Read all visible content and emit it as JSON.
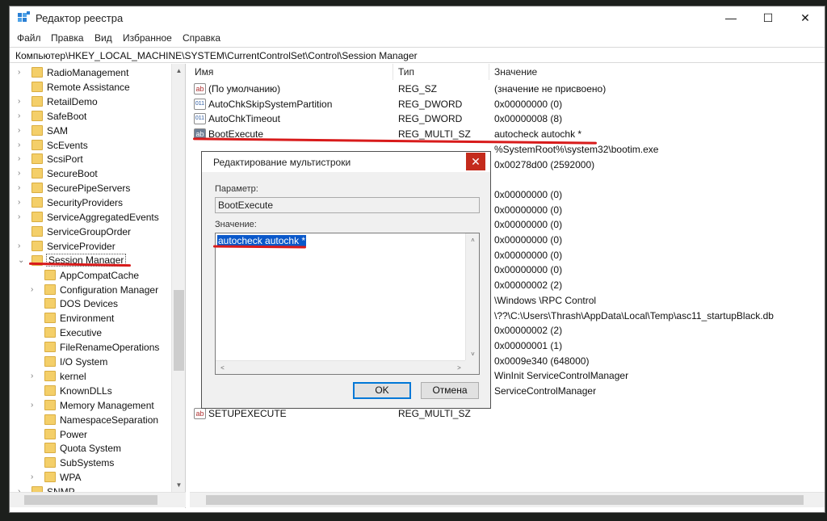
{
  "window": {
    "title": "Редактор реестра",
    "min": "—",
    "max": "☐",
    "close": "✕"
  },
  "menu": [
    "Файл",
    "Правка",
    "Вид",
    "Избранное",
    "Справка"
  ],
  "address": "Компьютер\\HKEY_LOCAL_MACHINE\\SYSTEM\\CurrentControlSet\\Control\\Session Manager",
  "tree": {
    "items": [
      {
        "label": "RadioManagement",
        "level": 0,
        "expander": ">"
      },
      {
        "label": "Remote Assistance",
        "level": 0,
        "expander": ""
      },
      {
        "label": "RetailDemo",
        "level": 0,
        "expander": ">"
      },
      {
        "label": "SafeBoot",
        "level": 0,
        "expander": ">"
      },
      {
        "label": "SAM",
        "level": 0,
        "expander": ">"
      },
      {
        "label": "ScEvents",
        "level": 0,
        "expander": ">"
      },
      {
        "label": "ScsiPort",
        "level": 0,
        "expander": ">"
      },
      {
        "label": "SecureBoot",
        "level": 0,
        "expander": ">"
      },
      {
        "label": "SecurePipeServers",
        "level": 0,
        "expander": ">"
      },
      {
        "label": "SecurityProviders",
        "level": 0,
        "expander": ">"
      },
      {
        "label": "ServiceAggregatedEvents",
        "level": 0,
        "expander": ">"
      },
      {
        "label": "ServiceGroupOrder",
        "level": 0,
        "expander": ""
      },
      {
        "label": "ServiceProvider",
        "level": 0,
        "expander": ">"
      },
      {
        "label": "Session Manager",
        "level": 0,
        "expander": "v",
        "selected": true
      },
      {
        "label": "AppCompatCache",
        "level": 1,
        "expander": ""
      },
      {
        "label": "Configuration Manager",
        "level": 1,
        "expander": ">"
      },
      {
        "label": "DOS Devices",
        "level": 1,
        "expander": ""
      },
      {
        "label": "Environment",
        "level": 1,
        "expander": ""
      },
      {
        "label": "Executive",
        "level": 1,
        "expander": ""
      },
      {
        "label": "FileRenameOperations",
        "level": 1,
        "expander": ""
      },
      {
        "label": "I/O System",
        "level": 1,
        "expander": ""
      },
      {
        "label": "kernel",
        "level": 1,
        "expander": ">"
      },
      {
        "label": "KnownDLLs",
        "level": 1,
        "expander": ""
      },
      {
        "label": "Memory Management",
        "level": 1,
        "expander": ">"
      },
      {
        "label": "NamespaceSeparation",
        "level": 1,
        "expander": ""
      },
      {
        "label": "Power",
        "level": 1,
        "expander": ""
      },
      {
        "label": "Quota System",
        "level": 1,
        "expander": ""
      },
      {
        "label": "SubSystems",
        "level": 1,
        "expander": ""
      },
      {
        "label": "WPA",
        "level": 1,
        "expander": ">"
      },
      {
        "label": "SNMP",
        "level": 0,
        "expander": ">"
      }
    ]
  },
  "list": {
    "columns": [
      "Имя",
      "Тип",
      "Значение"
    ],
    "rows": [
      {
        "icon": "ab",
        "name": "(По умолчанию)",
        "type": "REG_SZ",
        "value": "(значение не присвоено)"
      },
      {
        "icon": "bin",
        "name": "AutoChkSkipSystemPartition",
        "type": "REG_DWORD",
        "value": "0x00000000 (0)"
      },
      {
        "icon": "bin",
        "name": "AutoChkTimeout",
        "type": "REG_DWORD",
        "value": "0x00000008 (8)"
      },
      {
        "icon": "ab-sel",
        "name": "BootExecute",
        "type": "REG_MULTI_SZ",
        "value": "autocheck autochk *"
      },
      {
        "icon": "",
        "name": "",
        "type": "",
        "value": "%SystemRoot%\\system32\\bootim.exe"
      },
      {
        "icon": "",
        "name": "",
        "type": "",
        "value": "0x00278d00 (2592000)"
      },
      {
        "icon": "",
        "name": "",
        "type": "",
        "value": ""
      },
      {
        "icon": "",
        "name": "",
        "type": "",
        "value": "0x00000000 (0)"
      },
      {
        "icon": "",
        "name": "",
        "type": "",
        "value": "0x00000000 (0)"
      },
      {
        "icon": "",
        "name": "",
        "type": "",
        "value": "0x00000000 (0)"
      },
      {
        "icon": "",
        "name": "",
        "type": "",
        "value": "0x00000000 (0)"
      },
      {
        "icon": "",
        "name": "",
        "type": "",
        "value": "0x00000000 (0)"
      },
      {
        "icon": "",
        "name": "",
        "type": "",
        "value": "0x00000000 (0)"
      },
      {
        "icon": "",
        "name": "",
        "type": "",
        "value": "0x00000002 (2)"
      },
      {
        "icon": "",
        "name": "",
        "type": "",
        "value": "\\Windows \\RPC Control"
      },
      {
        "icon": "",
        "name": "",
        "type": "",
        "value": "\\??\\C:\\Users\\Thrash\\AppData\\Local\\Temp\\asc11_startupBlack.db"
      },
      {
        "icon": "",
        "name": "",
        "type": "",
        "value": "0x00000002 (2)"
      },
      {
        "icon": "",
        "name": "",
        "type": "",
        "value": "0x00000001 (1)"
      },
      {
        "icon": "",
        "name": "",
        "type": "",
        "value": "0x0009e340 (648000)"
      },
      {
        "icon": "",
        "name": "",
        "type": "",
        "value": "WinInit ServiceControlManager"
      },
      {
        "icon": "",
        "name": "",
        "type": "",
        "value": "ServiceControlManager"
      },
      {
        "icon": "ab",
        "name": "SETUPEXECUTE",
        "type": "REG_MULTI_SZ",
        "value": ""
      }
    ]
  },
  "dialog": {
    "title": "Редактирование мультистроки",
    "close": "✕",
    "param_label": "Параметр:",
    "param_value": "BootExecute",
    "value_label": "Значение:",
    "value_text": "autocheck autochk *",
    "ok": "OK",
    "cancel": "Отмена"
  },
  "colors": {
    "annotation_red": "#d81b1b",
    "selection_blue": "#0a58ca",
    "close_red": "#c42b1c"
  }
}
